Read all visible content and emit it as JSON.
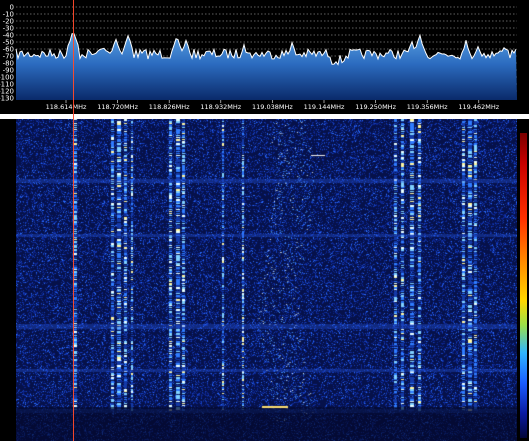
{
  "spectrum": {
    "db_labels": [
      "0",
      "-10",
      "-20",
      "-30",
      "-40",
      "-50",
      "-60",
      "-70",
      "-80",
      "-90",
      "-100",
      "-110",
      "-120",
      "-130"
    ],
    "freq_labels": [
      "118.614MHz",
      "118.720MHz",
      "118.826MHz",
      "118.932MHz",
      "119.038MHz",
      "119.144MHz",
      "119.250MHz",
      "119.356MHz",
      "119.462MHz"
    ]
  },
  "colors": {
    "background": "#000000",
    "waterfall_bg": "#06114a",
    "spectrum_fill_top": "#4a8fd6",
    "spectrum_fill_bottom": "#0a2a6a",
    "trace": "#ffffff",
    "cursor": "#ff4a2a"
  },
  "waterfall": {
    "signal_channels": [
      "118.614MHz",
      "118.720MHz",
      "118.826MHz",
      "119.356MHz",
      "119.462MHz"
    ]
  },
  "icons": [
    "colorbar-legend"
  ]
}
